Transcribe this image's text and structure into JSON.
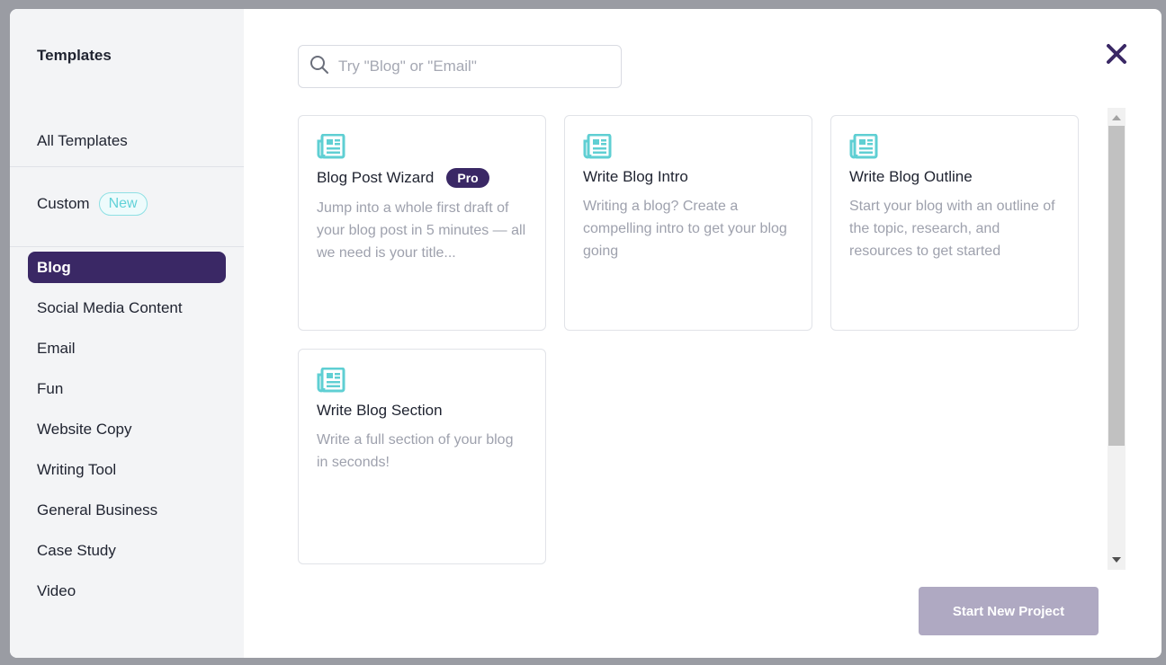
{
  "sidebar": {
    "title": "Templates",
    "all_templates": "All Templates",
    "custom": "Custom",
    "new_badge": "New",
    "categories": [
      {
        "label": "Blog",
        "active": true
      },
      {
        "label": "Social Media Content"
      },
      {
        "label": "Email"
      },
      {
        "label": "Fun"
      },
      {
        "label": "Website Copy"
      },
      {
        "label": "Writing Tool"
      },
      {
        "label": "General Business"
      },
      {
        "label": "Case Study"
      },
      {
        "label": "Video"
      }
    ]
  },
  "search": {
    "placeholder": "Try \"Blog\" or \"Email\"",
    "icon": "search-icon"
  },
  "close": {
    "icon": "close-icon"
  },
  "cards": [
    {
      "title": "Blog Post Wizard",
      "badge": "Pro",
      "description": "Jump into a whole first draft of your blog post in 5 minutes — all we need is your title...",
      "icon": "newspaper-icon"
    },
    {
      "title": "Write Blog Intro",
      "description": "Writing a blog? Create a compelling intro to get your blog going",
      "icon": "newspaper-icon"
    },
    {
      "title": "Write Blog Outline",
      "description": "Start your blog with an outline of the topic, research, and resources to get started",
      "icon": "newspaper-icon"
    },
    {
      "title": "Write Blog Section",
      "description": "Write a full section of your blog in seconds!",
      "icon": "newspaper-icon"
    }
  ],
  "actions": {
    "start_label": "Start New Project"
  },
  "colors": {
    "accent": "#3a2865",
    "icon_teal": "#5fcfd3",
    "button_disabled": "#afa9c2",
    "sidebar_bg": "#f3f4f6"
  }
}
